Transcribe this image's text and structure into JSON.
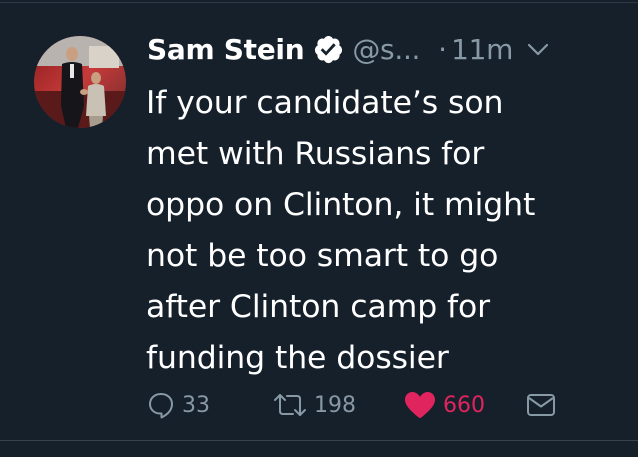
{
  "author": {
    "display_name": "Sam Stein",
    "handle": "@s...",
    "verified": true,
    "avatar_icon": "profile-photo"
  },
  "meta": {
    "separator": "·",
    "timestamp": "11m",
    "menu_icon": "chevron-down-icon"
  },
  "tweet": {
    "lines": [
      "If your candidate’s son",
      "met with Russians for",
      "oppo on Clinton, it might",
      "not be too smart to go",
      "after Clinton camp for",
      "funding the dossier"
    ]
  },
  "actions": {
    "reply": {
      "icon": "reply-icon",
      "count": "33"
    },
    "retweet": {
      "icon": "retweet-icon",
      "count": "198"
    },
    "like": {
      "icon": "heart-icon",
      "count": "660",
      "liked": true,
      "color": "#e0245e"
    },
    "dm": {
      "icon": "envelope-icon"
    }
  },
  "colors": {
    "background": "#15202b",
    "primary_text": "#ffffff",
    "secondary_text": "#8899a6",
    "like": "#e0245e"
  }
}
